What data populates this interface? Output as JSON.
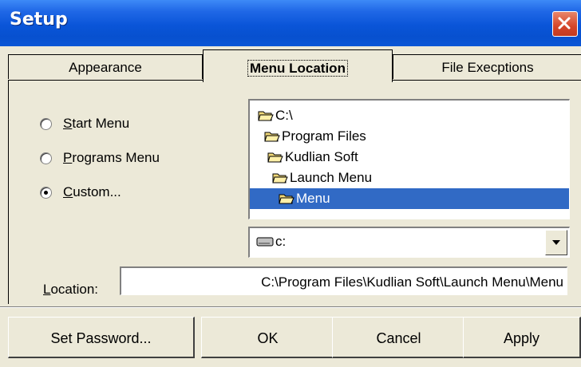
{
  "window": {
    "title": "Setup"
  },
  "tabs": [
    {
      "label": "Appearance",
      "active": false
    },
    {
      "label": "Menu Location",
      "active": true
    },
    {
      "label": "File Execptions",
      "active": false
    }
  ],
  "radios": [
    {
      "label_first": "S",
      "label_rest": "tart Menu",
      "checked": false
    },
    {
      "label_first": "P",
      "label_rest": "rograms Menu",
      "checked": false
    },
    {
      "label_first": "C",
      "label_rest": "ustom...",
      "checked": true
    }
  ],
  "tree": [
    {
      "label": "C:\\",
      "selected": false
    },
    {
      "label": "Program Files",
      "selected": false
    },
    {
      "label": "Kudlian Soft",
      "selected": false
    },
    {
      "label": "Launch Menu",
      "selected": false
    },
    {
      "label": "Menu",
      "selected": true
    }
  ],
  "drive": {
    "value": "c:"
  },
  "location": {
    "label_first": "L",
    "label_rest": "ocation:",
    "value": "C:\\Program Files\\Kudlian Soft\\Launch Menu\\Menu"
  },
  "buttons": {
    "set_password": "Set Password...",
    "ok": "OK",
    "cancel": "Cancel",
    "apply": "Apply"
  },
  "colors": {
    "titlebar": "#0a55d8",
    "selection": "#316ac5",
    "close": "#d5462a",
    "face": "#ece9d8"
  }
}
